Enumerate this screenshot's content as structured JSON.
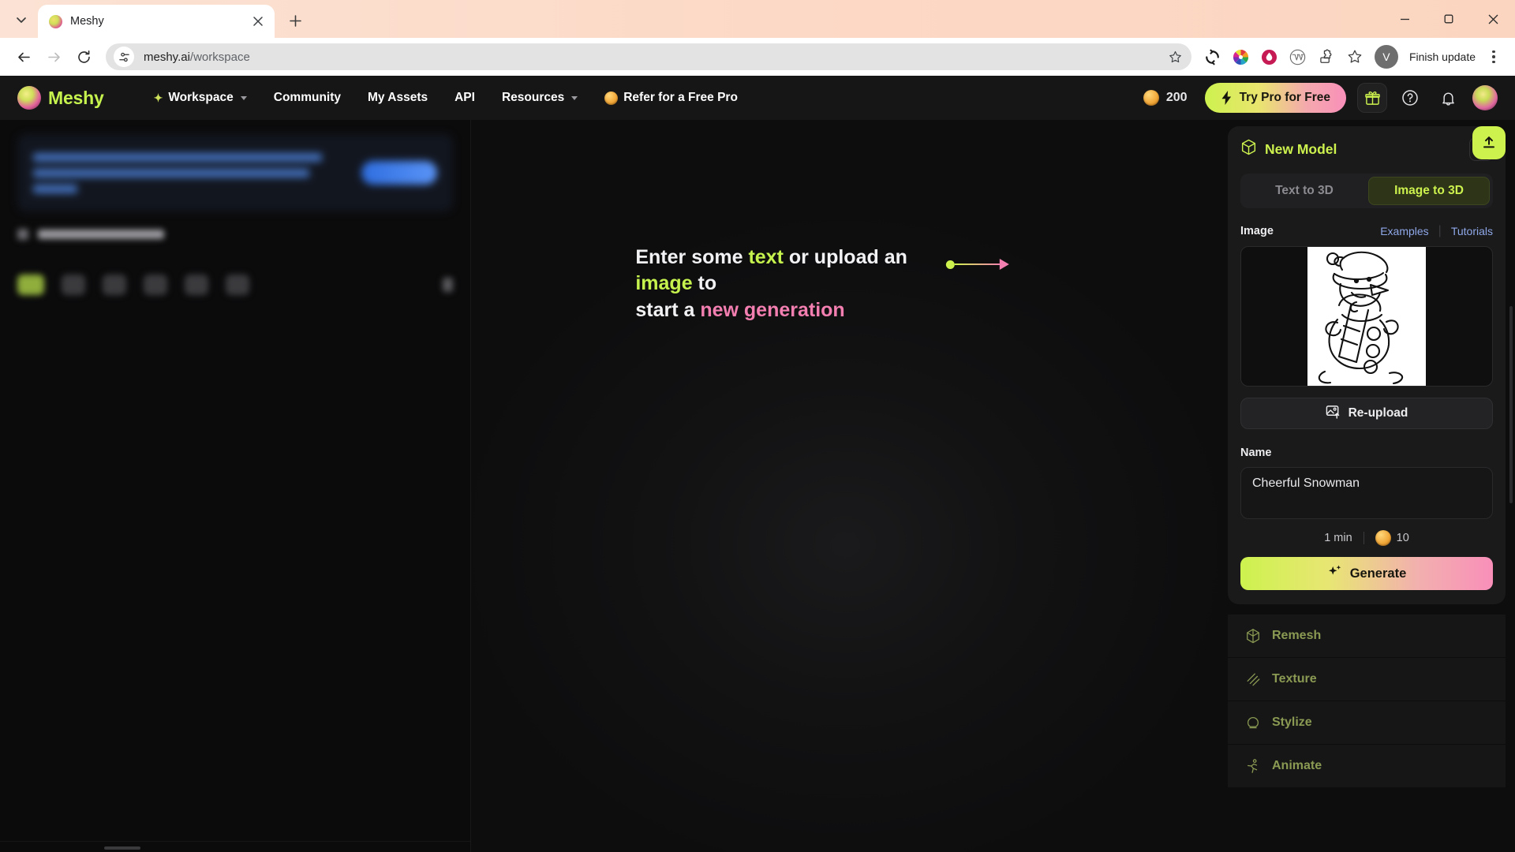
{
  "browser": {
    "tab": {
      "title": "Meshy",
      "favicon_name": "meshy-favicon"
    },
    "tab_list_label": "⌄",
    "new_tab_label": "+",
    "window": {
      "minimize": "—",
      "maximize": "□",
      "close": "✕"
    },
    "toolbar": {
      "back": "←",
      "forward": "→",
      "reload": "⟳",
      "url_host": "meshy.ai",
      "url_path": "/workspace",
      "url_full": "meshy.ai/workspace",
      "bookmark_star": "☆",
      "profile_initial": "V",
      "finish_update_label": "Finish update",
      "extensions": [
        "sync-refresh-icon",
        "color-wheel-icon",
        "water-drop-icon",
        "wordpress-icon",
        "puzzle-extensions-icon",
        "bookmarks-star-icon"
      ]
    }
  },
  "appnav": {
    "brand": "Meshy",
    "items": [
      {
        "label": "Workspace",
        "has_caret": true,
        "has_spark": true,
        "muted": false
      },
      {
        "label": "Community",
        "has_caret": false,
        "has_spark": false,
        "muted": false
      },
      {
        "label": "My Assets",
        "has_caret": false,
        "has_spark": false,
        "muted": false
      },
      {
        "label": "API",
        "has_caret": false,
        "has_spark": false,
        "muted": false
      },
      {
        "label": "Resources",
        "has_caret": true,
        "has_spark": false,
        "muted": false
      },
      {
        "label": "Refer for a Free Pro",
        "has_caret": false,
        "has_spark": false,
        "muted": false
      }
    ],
    "credits_value": "200",
    "try_pro_label": "Try Pro for Free",
    "icons": {
      "gift": "gift-icon",
      "help": "help-circle-icon",
      "bell": "bell-icon",
      "avatar": "user-avatar"
    }
  },
  "center": {
    "hint_line1_a": "Enter some ",
    "hint_text_word": "text",
    "hint_line1_b": " or upload an ",
    "hint_image_word": "image",
    "hint_line1_c": " to",
    "hint_line2_a": "start a ",
    "hint_new_gen": "new generation"
  },
  "right_panel": {
    "title": "New Model",
    "close_label": "✕",
    "tabs": [
      {
        "label": "Text to 3D",
        "active": false
      },
      {
        "label": "Image to 3D",
        "active": true
      }
    ],
    "image_section": {
      "label": "Image",
      "examples_link": "Examples",
      "tutorials_link": "Tutorials",
      "thumbnail_name": "snowman-line-art",
      "reupload_label": "Re-upload"
    },
    "name_section": {
      "label": "Name",
      "value": "Cheerful Snowman",
      "placeholder": "Name"
    },
    "cost": {
      "time": "1 min",
      "credits": "10"
    },
    "generate_label": "Generate",
    "actions": [
      {
        "label": "Remesh",
        "icon": "remesh-icon"
      },
      {
        "label": "Texture",
        "icon": "texture-icon"
      },
      {
        "label": "Stylize",
        "icon": "stylize-icon"
      },
      {
        "label": "Animate",
        "icon": "animate-icon"
      }
    ]
  },
  "colors": {
    "accent_green": "#cdf24e",
    "accent_pink": "#f98fb9",
    "panel_bg": "#1a1a1b",
    "app_bg": "#0d0d0e",
    "chrome_tabstrip": "#fbd9c6"
  }
}
